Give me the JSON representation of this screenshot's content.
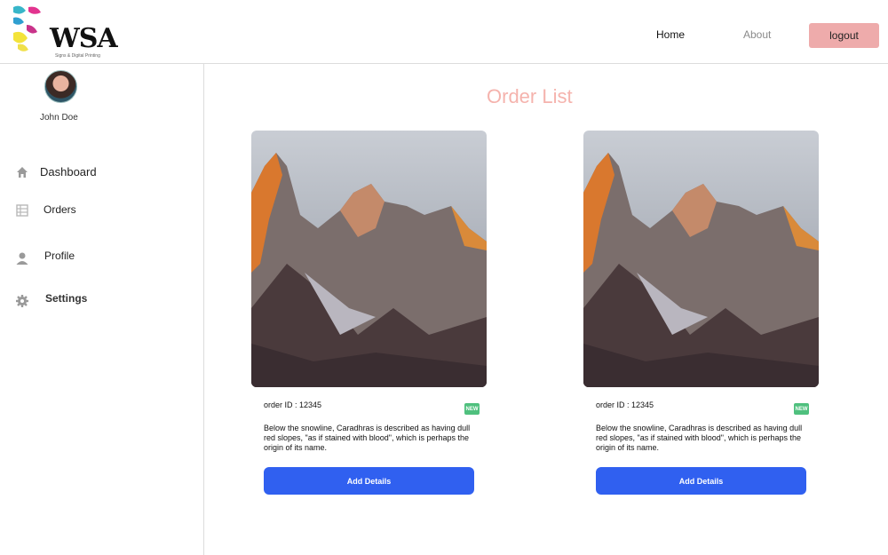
{
  "header": {
    "logo_text": "WSA",
    "logo_sub": "Signs & Digital Printing",
    "nav": {
      "home": "Home",
      "about": "About"
    },
    "logout_label": "logout"
  },
  "sidebar": {
    "user_name": "John Doe",
    "items": [
      {
        "label": "Dashboard",
        "icon": "home-icon",
        "active": false
      },
      {
        "label": "Orders",
        "icon": "list-icon",
        "active": true
      },
      {
        "label": "Profile",
        "icon": "user-icon",
        "active": false
      },
      {
        "label": "Settings",
        "icon": "gear-icon",
        "active": false
      }
    ]
  },
  "main": {
    "title": "Order List",
    "cards": [
      {
        "order_id": "order ID : 12345",
        "badge": "NEW",
        "description": "Below the snowline, Caradhras is described as having dull red slopes, \"as if stained with blood\", which is perhaps the origin of its name.",
        "button_label": "Add Details"
      },
      {
        "order_id": "order ID : 12345",
        "badge": "NEW",
        "description": "Below the snowline, Caradhras is described as having dull red slopes, \"as if stained with blood\", which is perhaps the origin of its name.",
        "button_label": "Add Details"
      }
    ]
  },
  "colors": {
    "accent_pink": "#f5b3ad",
    "logout_bg": "#eeabab",
    "button_blue": "#3060f0",
    "badge_green": "#4fc07e"
  }
}
